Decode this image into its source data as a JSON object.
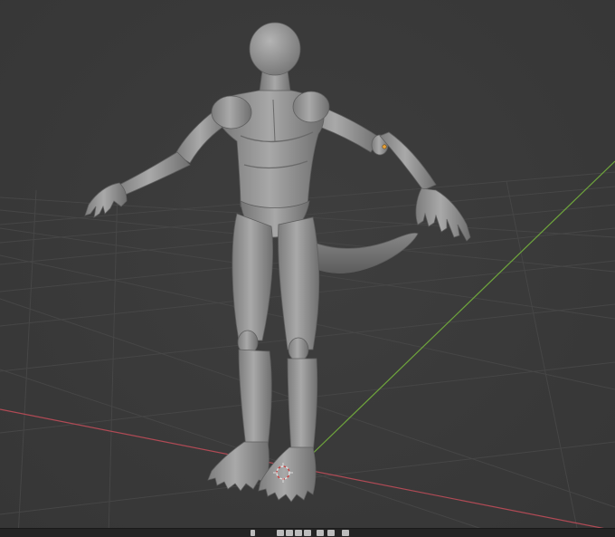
{
  "app": {
    "name": "3D viewport",
    "background_color": "#393939",
    "grid_color": "#444444",
    "x_axis_color": "#b04a55",
    "y_axis_color": "#6ea43c",
    "model_color": "#9a9a9a"
  },
  "viewport": {
    "view": "perspective",
    "selected_object": "humanoid-tail-model",
    "origin_marker": "orange-dot-icon",
    "cursor": "3d-cursor-icon"
  },
  "bottom_toolbar": {
    "icons": [
      "mouse-select-icon",
      "timeline-jump-start-icon",
      "timeline-prev-keyframe-icon",
      "timeline-play-reverse-icon",
      "timeline-play-icon",
      "timeline-next-keyframe-icon",
      "timeline-jump-end-icon"
    ]
  }
}
